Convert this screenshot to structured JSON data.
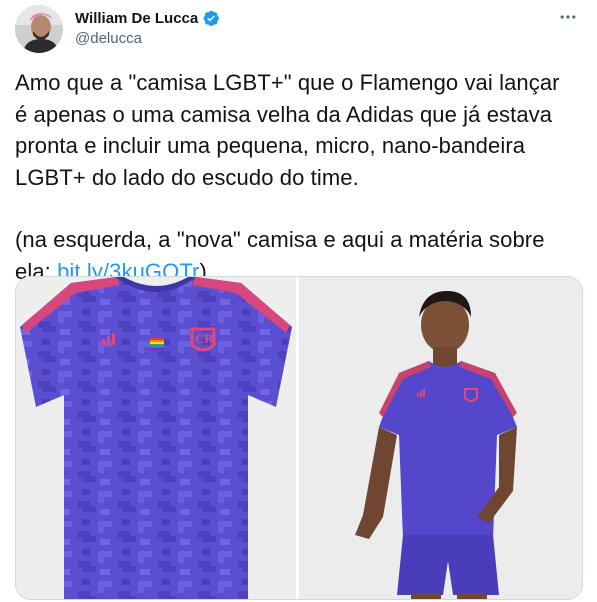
{
  "author": {
    "display_name": "William De Lucca",
    "handle": "@delucca",
    "verified": true,
    "avatar": "profile-photo"
  },
  "tweet": {
    "line1": "Amo que a \"camisa LGBT+\" que o Flamengo vai lançar é apenas o uma camisa velha da Adidas que já estava pronta e incluir uma pequena, micro, nano-bandeira LGBT+ do lado do escudo do time.",
    "line2_prefix": "(na esquerda, a \"nova\" camisa e aqui a matéria sobre ela: ",
    "link_text": "bit.ly/3kuGQTr",
    "line2_suffix": ")"
  },
  "media": {
    "left_image": "jersey-product-photo",
    "right_image": "model-wearing-jersey-photo"
  },
  "colors": {
    "link": "#1d9bf0",
    "text": "#0f1419",
    "secondary": "#536471",
    "verified": "#1d9bf0",
    "jersey": "#5a4fd1",
    "jersey_accent": "#e0487a"
  },
  "icons": {
    "verified": "verified-badge-icon",
    "more": "more-options-icon"
  }
}
